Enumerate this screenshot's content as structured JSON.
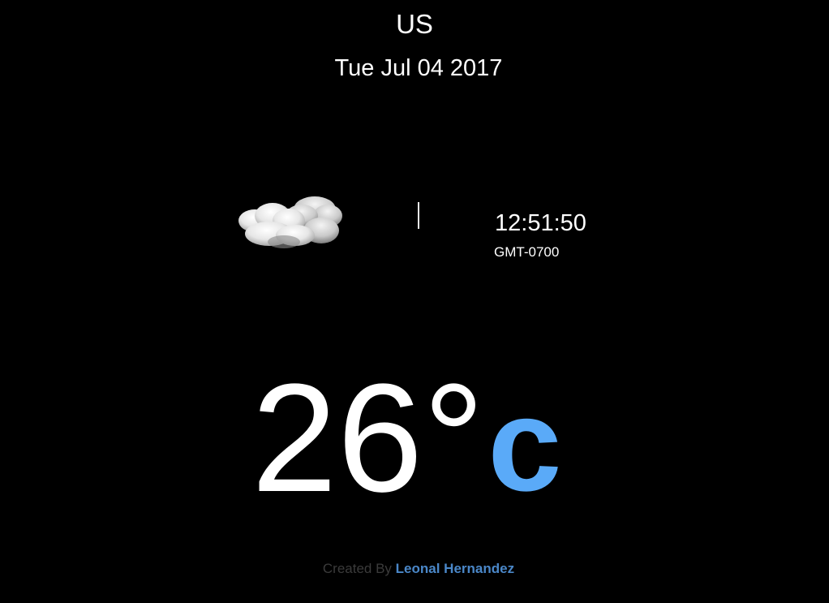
{
  "header": {
    "location": "US",
    "date": "Tue Jul 04 2017"
  },
  "weather": {
    "icon": "cloud-icon",
    "time": "12:51:50",
    "timezone": "GMT-0700",
    "temperature": "26°",
    "unit": "c"
  },
  "footer": {
    "prefix": "Created By",
    "author": "Leonal Hernandez"
  },
  "colors": {
    "background": "#000000",
    "text": "#ffffff",
    "unit_accent": "#5aaaf8",
    "author_link": "#4a87c8",
    "credit_text": "#3b3b3b"
  }
}
